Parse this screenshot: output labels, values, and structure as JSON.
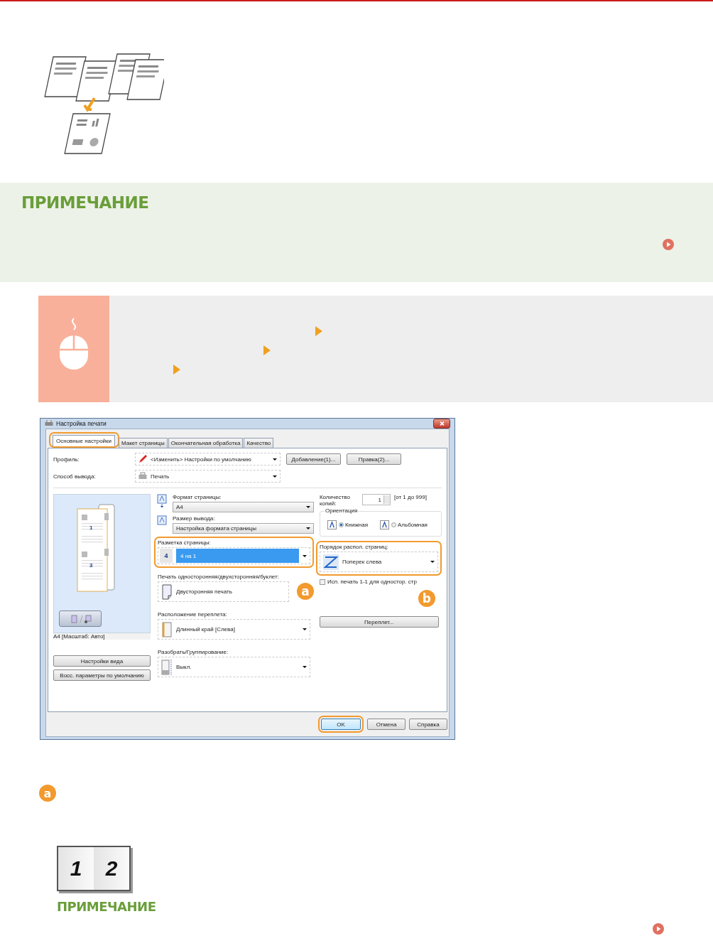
{
  "note": {
    "title": "ПРИМЕЧАНИЕ"
  },
  "dialog": {
    "title": "Настройка печати",
    "tabs": [
      {
        "label": "Основные настройки",
        "selected": true,
        "highlighted": true
      },
      {
        "label": "Макет страницы",
        "selected": false,
        "highlighted": false
      },
      {
        "label": "Окончательная обработка",
        "selected": false,
        "highlighted": false
      },
      {
        "label": "Качество",
        "selected": false,
        "highlighted": false
      }
    ],
    "profile": {
      "label": "Профиль:",
      "value": "<Изменить> Настройки по умолчанию"
    },
    "profile_buttons": [
      "Добавление(1)...",
      "Правка(2)..."
    ],
    "output_method": {
      "label": "Способ вывода:",
      "value": "Печать"
    },
    "preview": {
      "page_numbers": [
        "1",
        "3"
      ],
      "caption": "A4 [Масштаб: Авто]"
    },
    "left_buttons": [
      "Настройки вида",
      "Восс. параметры по умолчанию"
    ],
    "fields": [
      {
        "kind": "small",
        "label": "Формат страницы:",
        "value": "A4",
        "highlighted": false
      },
      {
        "kind": "small",
        "label": "Размер вывода:",
        "value": "Настройка формата страницы",
        "highlighted": false
      },
      {
        "kind": "layout",
        "label": "Разметка страницы:",
        "value": "4 на 1",
        "icon_text": "4",
        "highlighted": true
      },
      {
        "kind": "box",
        "label": "Печать односторонняя/двухсторонняя/буклет:",
        "value": "Двусторонняя печать",
        "highlighted": false,
        "badge": "a"
      },
      {
        "kind": "large",
        "label": "Расположение переплета:",
        "value": "Длинный край [Слева]",
        "highlighted": false
      },
      {
        "kind": "large",
        "label": "Разобрать/Группирование:",
        "value": "Выкл.",
        "highlighted": false
      }
    ],
    "copies": {
      "label": "Количество копий:",
      "value": "1",
      "range": "[от 1 до 999]"
    },
    "orientation": {
      "title": "Ориентация",
      "options": [
        {
          "label": "Книжная",
          "selected": true
        },
        {
          "label": "Альбомная",
          "selected": false
        }
      ]
    },
    "page_order": {
      "label": "Порядок распол. страниц:",
      "value": "Поперек слева",
      "highlighted": true,
      "badge": "b"
    },
    "one_to_one": {
      "label": "Исп. печать 1-1 для одностор. стр",
      "checked": false
    },
    "binding_button": "Переплет...",
    "footer_buttons": [
      {
        "label": "OK",
        "highlighted": true
      },
      {
        "label": "Отмена",
        "highlighted": false
      },
      {
        "label": "Справка",
        "highlighted": false
      }
    ]
  },
  "step_badge": "a",
  "sample": {
    "digits": [
      "1",
      "2"
    ]
  },
  "note2": {
    "title": "ПРИМЕЧАНИЕ"
  }
}
